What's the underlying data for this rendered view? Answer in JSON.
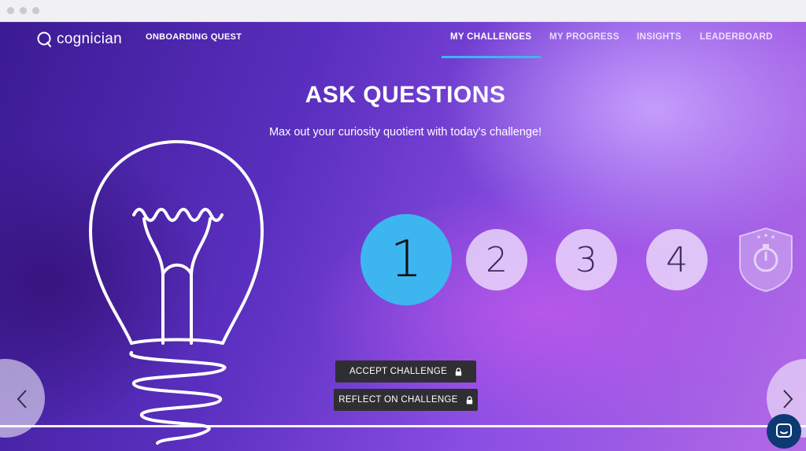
{
  "header": {
    "brand": "cognician",
    "quest_name": "ONBOARDING QUEST",
    "nav": [
      "MY CHALLENGES",
      "MY PROGRESS",
      "INSIGHTS",
      "LEADERBOARD"
    ],
    "active_nav": "MY CHALLENGES"
  },
  "hero": {
    "title": "ASK QUESTIONS",
    "subtitle": "Max out your curiosity quotient with today's challenge!"
  },
  "steps": [
    "1",
    "2",
    "3",
    "4"
  ],
  "active_step": "1",
  "actions": {
    "accept": "ACCEPT CHALLENGE",
    "reflect": "REFLECT ON CHALLENGE"
  },
  "icons": [
    "cognician-logo-icon",
    "lightbulb-illustration",
    "challenge-badge-icon",
    "lock-icon",
    "chevron-left-icon",
    "chevron-right-icon",
    "chat-icon"
  ],
  "colors": {
    "accent": "#3db5ef",
    "button": "#2f2f33",
    "chat": "#0e3a73"
  }
}
